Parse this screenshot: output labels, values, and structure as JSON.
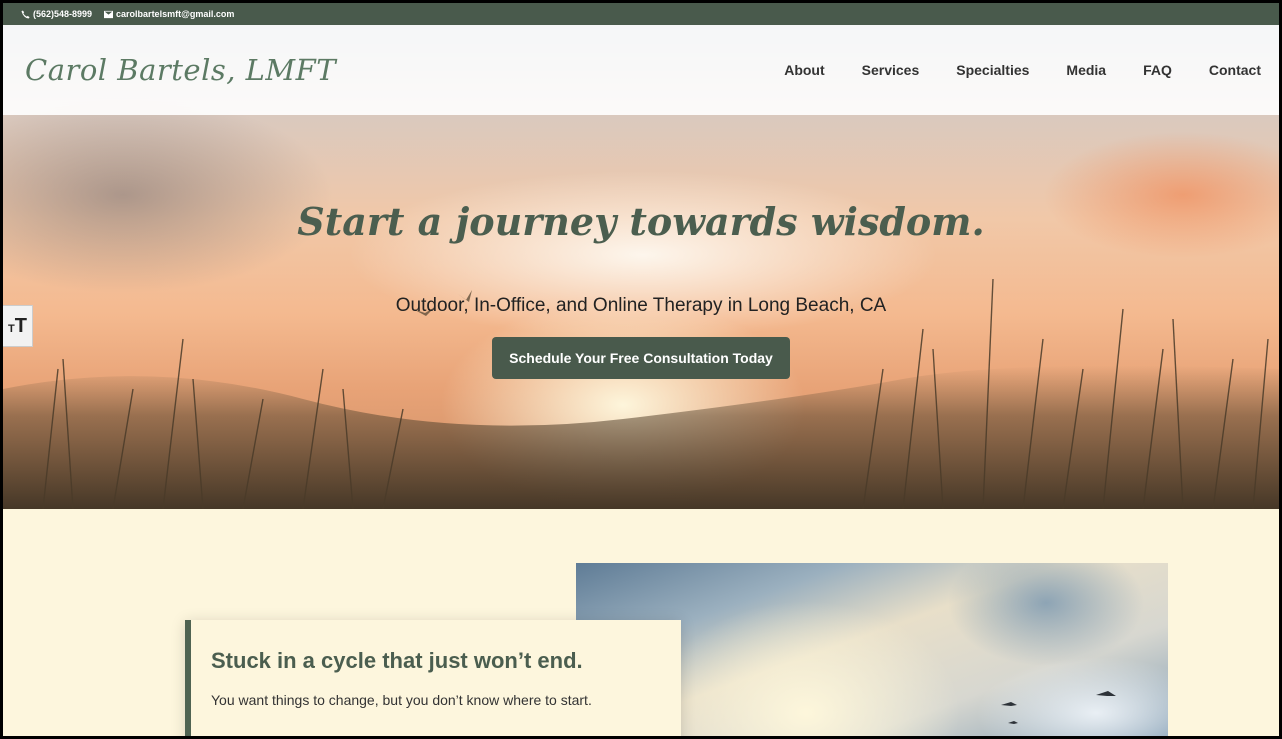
{
  "topbar": {
    "phone": "(562)548-8999",
    "email": "carolbartelsmft@gmail.com"
  },
  "header": {
    "logo": "Carol Bartels, LMFT",
    "nav": [
      "About",
      "Services",
      "Specialties",
      "Media",
      "FAQ",
      "Contact"
    ]
  },
  "hero": {
    "title": "Start a journey towards wisdom.",
    "subtitle": "Outdoor, In-Office, and Online Therapy in Long Beach, CA",
    "cta": "Schedule Your Free Consultation Today"
  },
  "accessibility": {
    "icon": "text-size-icon",
    "small_glyph": "T",
    "big_glyph": "T"
  },
  "intro": {
    "heading": "Stuck in a cycle that just won’t end.",
    "text": "You want things to change, but you don’t know where to start."
  },
  "colors": {
    "brand_green": "#495a4c",
    "cream": "#fdf6dd",
    "logo_green": "#5c7a64"
  }
}
